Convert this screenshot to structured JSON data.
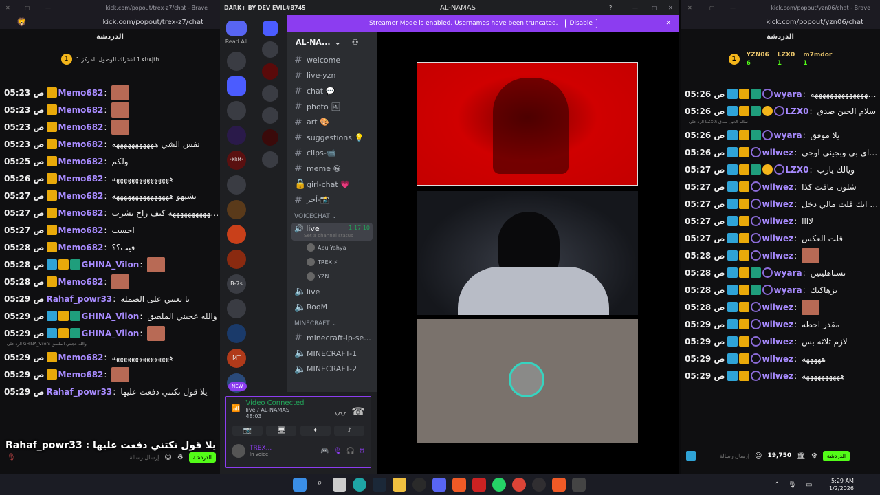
{
  "left_chat": {
    "tab_url": "kick.com/popout/trex-z7/chat - Brave",
    "url": "kick.com/popout/trex-z7/chat",
    "title": "الدردشة",
    "pinned": "إهداء 1 اشتراك للوصول للمركز 1th",
    "messages": [
      {
        "time": "05:23 ص",
        "user": "Memo682",
        "text": "",
        "img": true
      },
      {
        "time": "05:23 ص",
        "user": "Memo682",
        "text": "",
        "img": true
      },
      {
        "time": "05:23 ص",
        "user": "Memo682",
        "text": "",
        "img": true
      },
      {
        "time": "05:23 ص",
        "user": "Memo682",
        "text": "نفس الشي هههههههههههه"
      },
      {
        "time": "05:25 ص",
        "user": "Memo682",
        "text": "ولكم"
      },
      {
        "time": "05:26 ص",
        "user": "Memo682",
        "text": "هههههههههههههههه"
      },
      {
        "time": "05:27 ص",
        "user": "Memo682",
        "text": "تشبهو هههههههههههههههه"
      },
      {
        "time": "05:27 ص",
        "user": "Memo682",
        "text": "هههههههههههههههه كيف راح تشرب"
      },
      {
        "time": "05:27 ص",
        "user": "Memo682",
        "text": "احسب"
      },
      {
        "time": "05:28 ص",
        "user": "Memo682",
        "text": "فيب؟؟"
      },
      {
        "time": "05:28 ص",
        "user": "GHINA_Vilon",
        "text": "",
        "img": true
      },
      {
        "time": "05:28 ص",
        "user": "Memo682",
        "text": "",
        "img": true
      },
      {
        "time": "05:29 ص",
        "user": "Rahaf_powr33",
        "text": "يا يعيني على الصمله"
      },
      {
        "time": "05:29 ص",
        "user": "GHINA_Vilon",
        "text": "والله عجبني الملصق"
      },
      {
        "time": "05:29 ص",
        "user": "GHINA_Vilon",
        "text": "",
        "img": true
      },
      {
        "time": "05:29 ص",
        "user": "Memo682",
        "text": "هههههههههههههههه"
      },
      {
        "time": "05:29 ص",
        "user": "Memo682",
        "text": "",
        "img": true
      },
      {
        "time": "05:29 ص",
        "user": "Rahaf_powr33",
        "text": "يلا قول نكتني دفعت عليها"
      }
    ],
    "reply_note": "الرد على GHINA_Vilon: والله عجبني الملصق",
    "overlay_caption": "Rahaf_powr33 : يلا قول نكتني دفعت عليها",
    "input_placeholder": "إرسال رسالة",
    "send_label": "الدردشة"
  },
  "discord": {
    "app_title": "DARK+ BY DEV EVIL#8745",
    "window_title": "AL-NAMAS",
    "read_all": "Read All",
    "banner_text": "Streamer Mode is enabled. Usernames have been truncated.",
    "banner_button": "Disable",
    "server_name": "AL-NA...",
    "channels": [
      {
        "icon": "#",
        "name": "welcome"
      },
      {
        "icon": "#",
        "name": "live-yzn"
      },
      {
        "icon": "#",
        "name": "chat 💬"
      },
      {
        "icon": "#",
        "name": "photo 🖼"
      },
      {
        "icon": "#",
        "name": "art 🎨"
      },
      {
        "icon": "#",
        "name": "suggestions 💡"
      },
      {
        "icon": "#",
        "name": "clips-📹"
      },
      {
        "icon": "#",
        "name": "meme 😀"
      },
      {
        "icon": "🔒",
        "name": "girl-chat 💗"
      },
      {
        "icon": "#",
        "name": "أجر-📸"
      }
    ],
    "voice_category": "VOICECHAT",
    "voice_channel": "live",
    "voice_duration": "1:17:10",
    "voice_status": "Set a channel status",
    "voice_users": [
      "Abu Yahya",
      "TREX ⚡",
      "YZN"
    ],
    "voice2": "live",
    "voice3": "RooM",
    "mc_category": "MINECRAFT",
    "mc_channels": [
      "minecraft-ip-se...",
      "MINECRAFT-1",
      "MINECRAFT-2"
    ],
    "new_badge": "NEW",
    "video_status": "Video Connected",
    "video_channel": "live / AL-NAMAS",
    "video_time": "48:03",
    "user_name": "TREX...",
    "user_status": "In voice",
    "server_letters": "B-7s",
    "server_krm": "•KRM•",
    "server_mt": "MT"
  },
  "right_chat": {
    "tab_url": "kick.com/popout/yzn06/chat - Brave",
    "url": "kick.com/popout/yzn06/chat",
    "title": "الدردشة",
    "top": [
      {
        "name": "YZN06",
        "count": "6"
      },
      {
        "name": "LZX0",
        "count": "1"
      },
      {
        "name": "m7mdor",
        "count": "1"
      }
    ],
    "messages": [
      {
        "time": "05:26 ص",
        "user": "wyara",
        "text": "هههههههههههههههههههههههههههههههههههههههههههههههههههه"
      },
      {
        "time": "05:26 ص",
        "user": "LZX0",
        "text": "سلام الحين صدق"
      },
      {
        "time": "05:26 ص",
        "user": "wyara",
        "text": "يلا موفق"
      },
      {
        "time": "05:26 ص",
        "user": "wllwez",
        "text": "اليوم جمعه ابشتري في اي بي وبجيني اوجي"
      },
      {
        "time": "05:27 ص",
        "user": "LZX0",
        "text": "ويالك يارب"
      },
      {
        "time": "05:27 ص",
        "user": "wllwez",
        "text": "شلون مافت كذا"
      },
      {
        "time": "05:27 ص",
        "user": "wllwez",
        "text": "والله انك قلت مالي دخل"
      },
      {
        "time": "05:27 ص",
        "user": "wllwez",
        "text": "لاااا"
      },
      {
        "time": "05:27 ص",
        "user": "wllwez",
        "text": "قلت العكس"
      },
      {
        "time": "05:28 ص",
        "user": "wllwez",
        "text": "",
        "img": true
      },
      {
        "time": "05:28 ص",
        "user": "wyara",
        "text": "تستاهليتين"
      },
      {
        "time": "05:28 ص",
        "user": "wyara",
        "text": "بزهاكتك"
      },
      {
        "time": "05:28 ص",
        "user": "wllwez",
        "text": "",
        "img": true
      },
      {
        "time": "05:29 ص",
        "user": "wllwez",
        "text": "مقدر احطه"
      },
      {
        "time": "05:29 ص",
        "user": "wllwez",
        "text": "لازم ثلاثه بس"
      },
      {
        "time": "05:29 ص",
        "user": "wllwez",
        "text": "هههههه"
      },
      {
        "time": "05:29 ص",
        "user": "wllwez",
        "text": "ههههههههههه"
      }
    ],
    "reply_note": "الرد على LZX0: سلام الحين صدق",
    "input_placeholder": "إرسال رسالة",
    "points": "19,750",
    "send_label": "الدردشة"
  },
  "taskbar": {
    "time": "5:29 AM",
    "date": "1/2/2026"
  }
}
